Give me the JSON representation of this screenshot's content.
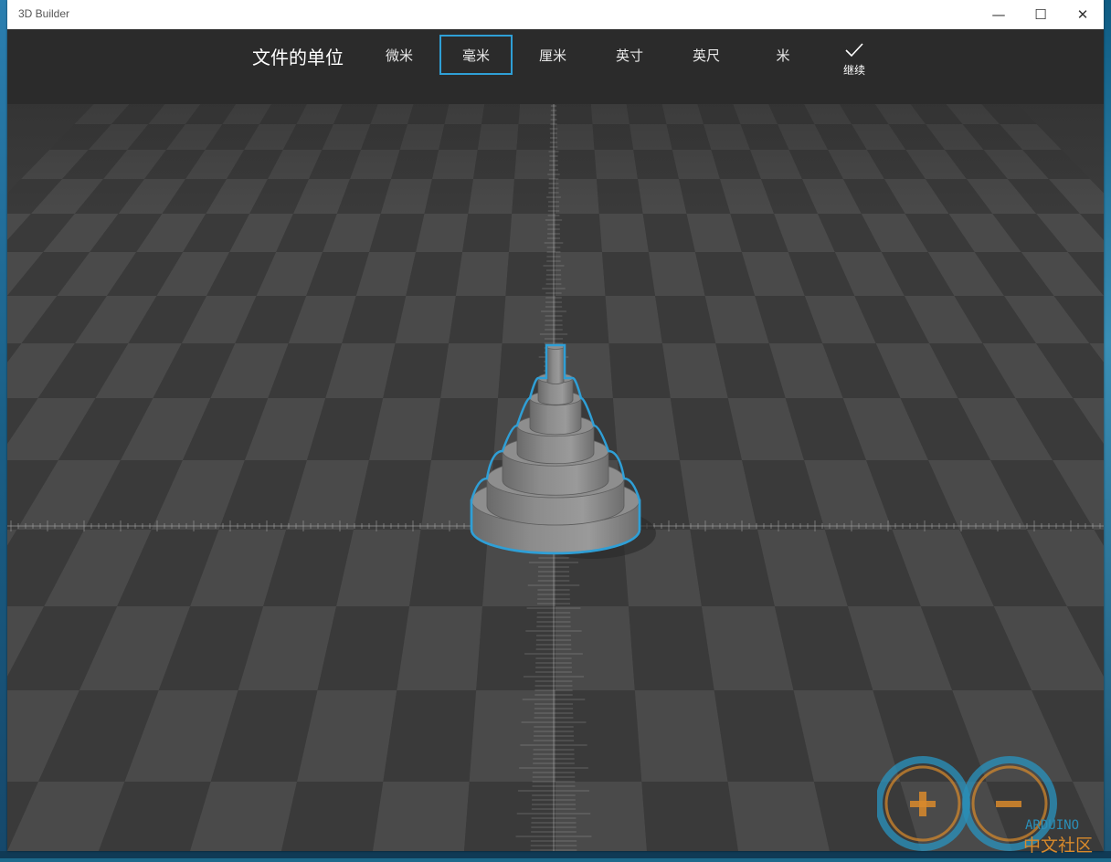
{
  "window": {
    "title": "3D Builder"
  },
  "window_controls": {
    "minimize": "—",
    "maximize": "☐",
    "close": "✕"
  },
  "units_bar": {
    "heading": "文件的单位",
    "units": [
      {
        "label": "微米"
      },
      {
        "label": "毫米",
        "selected": true
      },
      {
        "label": "厘米"
      },
      {
        "label": "英寸"
      },
      {
        "label": "英尺"
      },
      {
        "label": "米"
      }
    ],
    "continue_label": "继续",
    "continue_icon": "checkmark-icon"
  },
  "scene": {
    "model": "stacked-cylinder-tower",
    "selection_color": "#2f9fd6"
  },
  "watermark": {
    "text_top": "ARDUINO",
    "text_bottom": "中文社区"
  },
  "colors": {
    "toolbar_bg": "#2b2b2b",
    "accent": "#2f9fd6",
    "floor_dark": "#3a3a3a",
    "floor_light": "#4a4a4a"
  }
}
